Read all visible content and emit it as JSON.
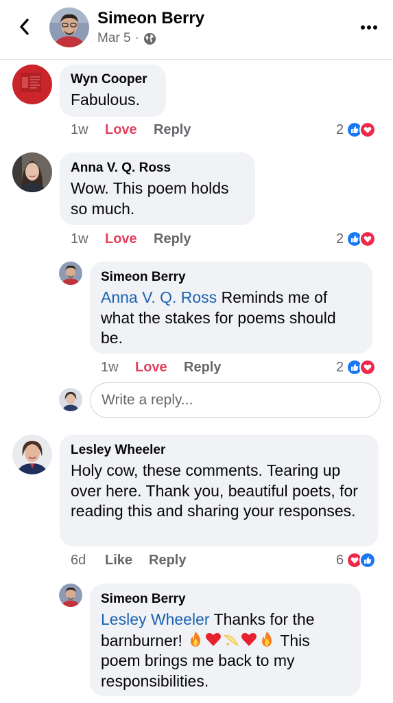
{
  "header": {
    "author": "Simeon Berry",
    "date": "Mar 5",
    "separator": "·",
    "privacy_icon": "globe-icon",
    "back_icon": "chevron-left-icon",
    "more_icon": "more-horizontal-icon"
  },
  "colors": {
    "love": "#e4405f",
    "like_blue": "#1877f2",
    "mention": "#1b63b2",
    "bubble": "#f0f2f5",
    "meta_gray": "#65676b"
  },
  "comments": [
    {
      "name": "Wyn Cooper",
      "text": "Fabulous.",
      "time": "1w",
      "reaction_action": "Love",
      "reply_label": "Reply",
      "reaction_count": "2",
      "reactions": [
        "like",
        "love"
      ]
    },
    {
      "name": "Anna V. Q. Ross",
      "text": "Wow. This poem holds so much.",
      "time": "1w",
      "reaction_action": "Love",
      "reply_label": "Reply",
      "reaction_count": "2",
      "reactions": [
        "like",
        "love"
      ],
      "replies": [
        {
          "name": "Simeon Berry",
          "mention": "Anna V. Q. Ross",
          "text": "Reminds me of what the stakes for poems should be.",
          "time": "1w",
          "reaction_action": "Love",
          "reply_label": "Reply",
          "reaction_count": "2",
          "reactions": [
            "like",
            "love"
          ]
        }
      ],
      "reply_box": {
        "placeholder": "Write a reply..."
      }
    },
    {
      "name": "Lesley Wheeler",
      "text": "Holy cow, these comments. Tearing up over here. Thank you, beautiful poets, for reading this and sharing your responses.",
      "time": "6d",
      "reaction_action": "Like",
      "reply_label": "Reply",
      "reaction_count": "6",
      "reactions": [
        "love",
        "like"
      ],
      "replies": [
        {
          "name": "Simeon Berry",
          "mention": "Lesley Wheeler",
          "text_before": "Thanks for the barnburner!",
          "emojis": [
            "fire",
            "red-heart",
            "dizzy",
            "red-heart",
            "fire"
          ],
          "text_after": "This poem brings me back to my responsibilities."
        }
      ]
    }
  ]
}
